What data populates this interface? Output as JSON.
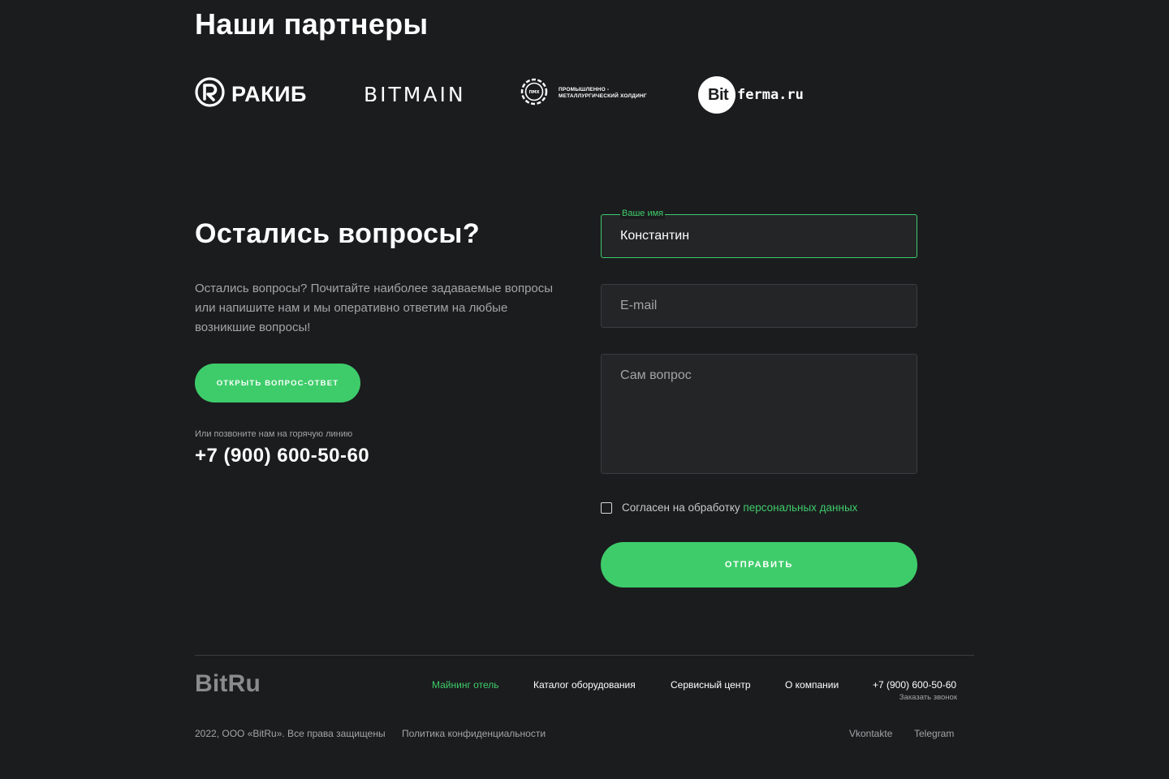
{
  "partners": {
    "title": "Наши партнеры",
    "rakib": {
      "name": "РАКИБ",
      "icon": "rakib-logo-icon"
    },
    "bitmain": {
      "name": "BITMAIN"
    },
    "pmh": {
      "badge": "ПМХ",
      "line1": "ПРОМЫШЛЕННО -",
      "line2": "МЕТАЛЛУРГИЧЕСКИЙ ХОЛДИНГ"
    },
    "bitferma": {
      "prefix": "Bit",
      "suffix": "ferma.ru"
    }
  },
  "questions": {
    "title": "Остались вопросы?",
    "description": "Остались вопросы? Почитайте наиболее задаваемые вопросы или напишите нам и мы оперативно ответим на любые возникшие вопросы!",
    "faq_button": "ОТКРЫТЬ ВОПРОС-ОТВЕТ",
    "hotline_label": "Или позвоните нам на горячую линию",
    "hotline_phone": "+7 (900) 600-50-60"
  },
  "form": {
    "name_label": "Ваше имя",
    "name_value": "Константин",
    "email_placeholder": "E-mail",
    "question_placeholder": "Сам вопрос",
    "consent_text": "Согласен на обработку ",
    "consent_link": "персональных данных",
    "consent_checked": false,
    "submit": "ОТПРАВИТЬ"
  },
  "footer": {
    "logo": "BitRu",
    "nav": [
      {
        "label": "Майнинг отель",
        "active": true
      },
      {
        "label": "Каталог оборудования",
        "active": false
      },
      {
        "label": "Сервисный центр",
        "active": false
      },
      {
        "label": "О компании",
        "active": false
      }
    ],
    "phone": "+7 (900) 600-50-60",
    "callback": "Заказать звонок",
    "copyright": "2022, ООО «BitRu». Все права защищены",
    "privacy": "Политика конфиденциальности",
    "socials": [
      "Vkontakte",
      "Telegram"
    ]
  },
  "colors": {
    "background": "#1b1c1e",
    "accent": "#3ecc6a",
    "field_bg": "#242527",
    "muted_text": "#a3a4a6"
  }
}
